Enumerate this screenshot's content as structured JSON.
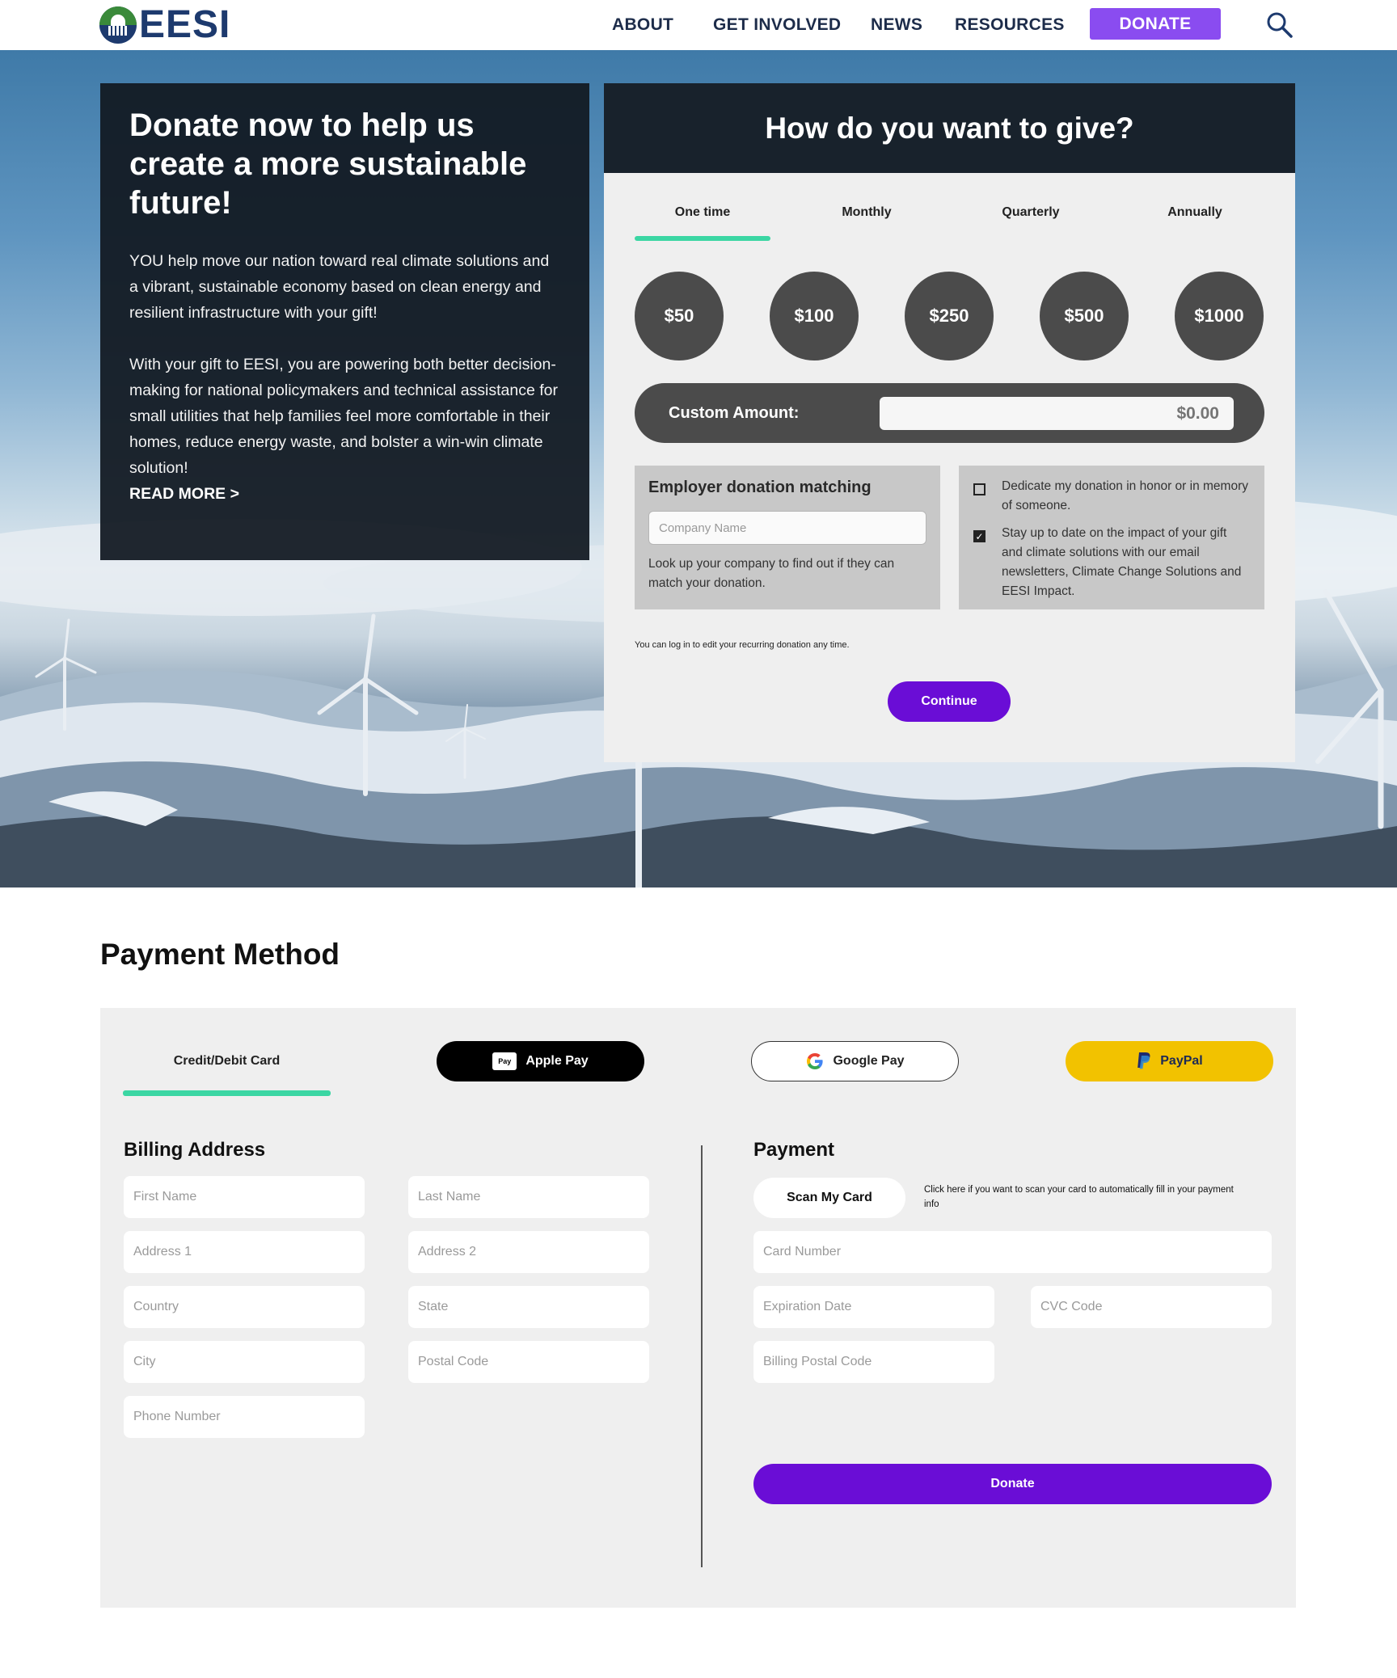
{
  "brand": {
    "name": "EESI",
    "accent": "#8a4cf0",
    "primary": "#6a0dd6",
    "tab_indicator": "#3bd6a3",
    "navy": "#1d3a6e"
  },
  "nav": {
    "items": [
      "ABOUT",
      "GET INVOLVED",
      "NEWS",
      "RESOURCES"
    ],
    "donate_label": "DONATE",
    "search_icon": "search-icon"
  },
  "intro": {
    "title": "Donate now to help us create a more sustainable future!",
    "paragraph1": "YOU help move our nation toward real climate solutions and a vibrant, sustainable economy based on clean energy and resilient infrastructure with your gift!",
    "paragraph2": "With your gift to EESI, you are powering both better decision-making for national policymakers and technical assistance for small utilities that help families feel more comfortable in their homes, reduce energy waste, and bolster a win-win climate solution!",
    "read_more": "READ MORE >"
  },
  "give": {
    "title": "How do you want to give?",
    "frequencies": [
      "One time",
      "Monthly",
      "Quarterly",
      "Annually"
    ],
    "selected_frequency": "One time",
    "amounts": [
      "$50",
      "$100",
      "$250",
      "$500",
      "$1000"
    ],
    "custom_label": "Custom Amount:",
    "custom_placeholder": "$0.00",
    "employer_title": "Employer donation matching",
    "company_placeholder": "Company Name",
    "employer_help": "Look up your company to find out if they can match your donation.",
    "options": [
      {
        "label": "Dedicate my donation in honor or in memory of someone.",
        "checked": false
      },
      {
        "label": "Stay up to date on the impact of your gift and climate solutions with our email newsletters, Climate Change Solutions and EESI Impact.",
        "checked": true
      }
    ],
    "recurring_note": "You can log in to edit your recurring donation any time.",
    "continue_label": "Continue"
  },
  "payment": {
    "section_title": "Payment Method",
    "methods": [
      "Credit/Debit Card",
      "Apple Pay",
      "Google Pay",
      "PayPal"
    ],
    "selected_method": "Credit/Debit Card",
    "apple_badge": "Pay",
    "billing_title": "Billing Address",
    "billing_fields": {
      "first_name": "First Name",
      "last_name": "Last Name",
      "address1": "Address 1",
      "address2": "Address 2",
      "country": "Country",
      "state": "State",
      "city": "City",
      "postal_code": "Postal Code",
      "phone": "Phone Number"
    },
    "payment_title": "Payment",
    "scan_label": "Scan My Card",
    "scan_note": "Click here if you want to scan your card to automatically fill in your payment info",
    "card_fields": {
      "card_number": "Card Number",
      "expiration": "Expiration Date",
      "cvc": "CVC Code",
      "billing_postal": "Billing Postal Code"
    },
    "donate_label": "Donate"
  }
}
